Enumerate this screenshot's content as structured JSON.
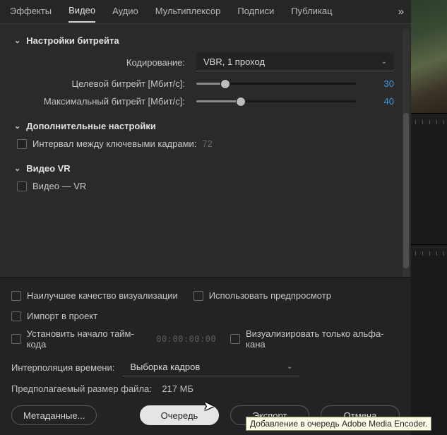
{
  "tabs": {
    "effects": "Эффекты",
    "video": "Видео",
    "audio": "Аудио",
    "mux": "Мультиплексор",
    "captions": "Подписи",
    "publish": "Публикац",
    "overflow": "»"
  },
  "bitrate": {
    "title": "Настройки битрейта",
    "encoding_label": "Кодирование:",
    "encoding_value": "VBR, 1 проход",
    "target_label": "Целевой битрейт [Мбит/с]:",
    "target_value": "30",
    "max_label": "Максимальный битрейт [Мбит/с]:",
    "max_value": "40"
  },
  "advanced": {
    "title": "Дополнительные настройки",
    "keyframe_label": "Интервал между ключевыми кадрами:",
    "keyframe_value": "72"
  },
  "vr": {
    "title": "Видео VR",
    "check_label": "Видео — VR"
  },
  "options": {
    "best_quality": "Наилучшее качество визуализации",
    "use_preview": "Использовать предпросмотр",
    "import_project": "Импорт в проект",
    "set_timecode": "Установить начало тайм-кода",
    "timecode_value": "00:00:00:00",
    "render_alpha": "Визуализировать только альфа-кана"
  },
  "interpolation": {
    "label": "Интерполяция времени:",
    "value": "Выборка кадров"
  },
  "estimate": {
    "label": "Предполагаемый размер файла:",
    "value": "217 МБ"
  },
  "buttons": {
    "metadata": "Метаданные...",
    "queue": "Очередь",
    "export": "Экспорт",
    "cancel": "Отмена"
  },
  "tooltip": "Добавление в очередь Adobe Media Encoder."
}
